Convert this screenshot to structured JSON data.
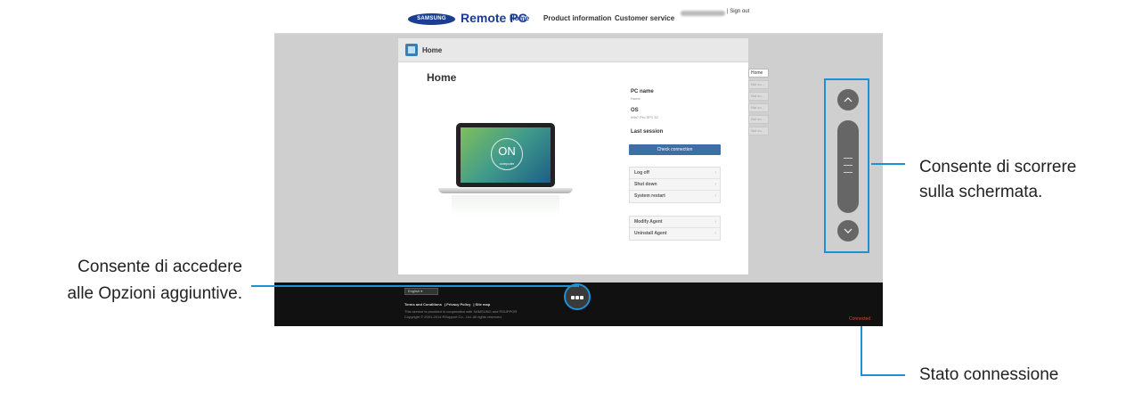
{
  "header": {
    "logo_text": "SAMSUNG",
    "app_title": "Remote PC",
    "nav": [
      "Home",
      "Product information",
      "Customer service"
    ],
    "sign_out": "| Sign out"
  },
  "card": {
    "header_title": "Home",
    "title": "Home",
    "device": {
      "status_big": "ON",
      "status_small": "computer"
    },
    "info": [
      {
        "label": "PC name",
        "value": "Home"
      },
      {
        "label": "OS",
        "value": "Win7 Pro SP1 32"
      },
      {
        "label": "Last session",
        "value": ""
      }
    ],
    "check_button": "Check connection",
    "power_menu": [
      "Log off",
      "Shut down",
      "System restart"
    ],
    "agent_menu": [
      "Modify Agent",
      "Uninstall Agent"
    ]
  },
  "side_tabs": [
    "Home",
    "Not co...",
    "Not co...",
    "Not co...",
    "Not co...",
    "Not co..."
  ],
  "footer": {
    "language": "English",
    "links": [
      "Terms and Conditions",
      "Privacy Policy",
      "Site map"
    ],
    "line1": "This service is provided in cooperation with SAMSUNG and RSUPPOR",
    "line2": "Copyright © 2001-2014 RSupport Co., Ltd. All rights reserved.",
    "status": "Connected"
  },
  "callouts": {
    "scroll_line1": "Consente di scorrere",
    "scroll_line2": "sulla schermata.",
    "more_line1": "Consente di accedere",
    "more_line2": "alle Opzioni aggiuntive.",
    "status": "Stato connessione"
  },
  "colors": {
    "accent": "#1e90d6",
    "brand": "#1a3d8f",
    "status": "#e0483a"
  }
}
